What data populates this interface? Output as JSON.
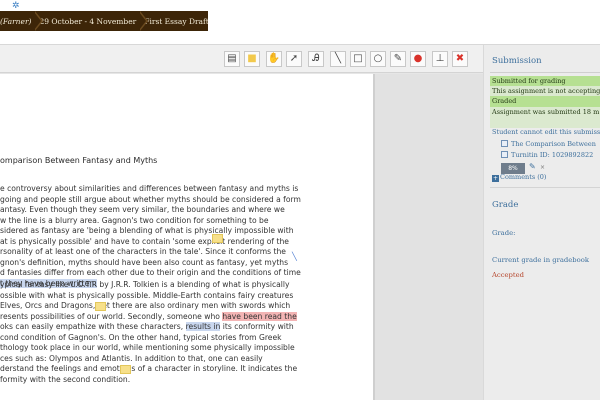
{
  "breadcrumb": {
    "items": [
      "(Farner)",
      "29 October - 4 November",
      "First Essay Draft"
    ]
  },
  "toolbar": {
    "tools": [
      {
        "name": "comment-tool-icon",
        "glyph": "▤"
      },
      {
        "name": "sticky-note-tool-icon",
        "glyph": "■"
      },
      {
        "name": "pan-tool-icon",
        "glyph": "✋"
      },
      {
        "name": "select-tool-icon",
        "glyph": "➚"
      },
      {
        "name": "stamp-text-tool-icon",
        "glyph": "Ꭿ"
      },
      {
        "name": "line-tool-icon",
        "glyph": "╲"
      },
      {
        "name": "rectangle-tool-icon",
        "glyph": "□"
      },
      {
        "name": "oval-tool-icon",
        "glyph": "○"
      },
      {
        "name": "pen-tool-icon",
        "glyph": "✎"
      },
      {
        "name": "color-tool-icon",
        "glyph": "●"
      },
      {
        "name": "stamp-tool-icon",
        "glyph": "⊥"
      },
      {
        "name": "delete-tool-icon",
        "glyph": "✖"
      }
    ]
  },
  "document": {
    "title": "omparison Between Fantasy and Myths",
    "para1": [
      "e controversy about similarities and differences between fantasy and myths is",
      "going and people still argue about whether myths should be considered a form",
      "antasy. Even though they seem very similar, the boundaries and where we",
      "w the line is a blurry area. Gagnon's two condition for something to be",
      "sidered as fantasy are 'being a blending of what is physically impossible with",
      "at is physically possible' and have to contain 'some explicit rendering of the",
      "rsonality of at least one of the characters in the tale'. Since it conforms the",
      "gnon's definition, myths should have been also count as fantasy, yet myths",
      "d fantasies differ from each other due to their origin and the conditions of time"
    ],
    "para1_highlight": "t they have been written.",
    "para2": [
      "ypical fantasy like L.O.T.R by J.R.R. Tolkien is a blending of what is physically",
      "ossible with what is physically possible. Middle-Earth contains fairy creatures",
      " Elves, Orcs and Dragons, yet there are also ordinary men with swords which",
      "resents possibilities of our world. Secondly, someone who ",
      "oks can easily empathize with these characters, ",
      "cond condition of Gagnon's.  On the other hand, typical stories from Greek",
      "thology took place in our world, while mentioning some physically impossible",
      "ces such as: Olympos and Atlantis. In addition to that, one can easily",
      "derstand the feelings and emotions of a character in storyline. It indicates the",
      "formity with the second condition."
    ],
    "para2_red": "have been read the",
    "para2_blue": "results in",
    "para2_tail": " its conformity with"
  },
  "panel": {
    "heading": "Submission",
    "status": [
      "Submitted for grading",
      "This assignment is not accepting",
      "Graded",
      "Assignment was submitted 18 m"
    ],
    "cannot_edit": "Student cannot edit this submiss",
    "file_name": "The Comparison Between",
    "turnitin": "Turnitin ID: 1029892822",
    "score": "8%",
    "comments": "Comments (0)",
    "grade_heading": "Grade",
    "grade_label": "Grade:",
    "gradebook_link": "Current grade in gradebook",
    "accepted": "Accepted"
  },
  "colors": {
    "breadcrumb_bg": "#3d2508",
    "link": "#3d6f9c",
    "status_green": "#b6e092",
    "accepted_red": "#b5452b",
    "highlight_blue": "#c9d7ef",
    "highlight_red": "#f3b4b4",
    "note_yellow": "#f7e08a"
  }
}
